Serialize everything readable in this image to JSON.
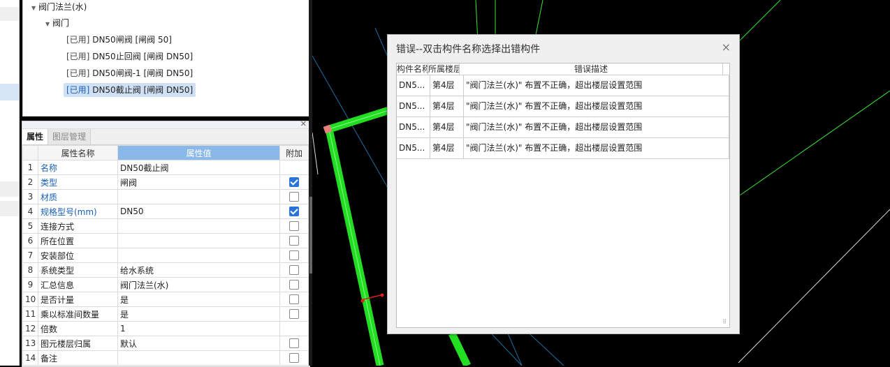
{
  "tree": {
    "group": "阀门法兰(水)",
    "subgroup": "阀门",
    "items": [
      {
        "tag": "[已用]",
        "label": "DN50闸阀 [闸阀 50]"
      },
      {
        "tag": "[已用]",
        "label": "DN50止回阀 [闸阀 DN50]"
      },
      {
        "tag": "[已用]",
        "label": "DN50闸阀-1 [闸阀 DN50]"
      },
      {
        "tag": "[已用]",
        "label": "DN50截止阀 [闸阀 DN50]"
      }
    ]
  },
  "props": {
    "tabs": [
      "属性",
      "图层管理"
    ],
    "headers": {
      "name": "属性名称",
      "value": "属性值",
      "extra": "附加"
    },
    "rows": [
      {
        "n": "1",
        "name": "名称",
        "value": "DN50截止阀",
        "blue": true,
        "cb": null
      },
      {
        "n": "2",
        "name": "类型",
        "value": "闸阀",
        "blue": true,
        "cb": true
      },
      {
        "n": "3",
        "name": "材质",
        "value": "",
        "blue": true,
        "cb": false
      },
      {
        "n": "4",
        "name": "规格型号(mm)",
        "value": "DN50",
        "blue": true,
        "cb": true
      },
      {
        "n": "5",
        "name": "连接方式",
        "value": "",
        "blue": false,
        "cb": false
      },
      {
        "n": "6",
        "name": "所在位置",
        "value": "",
        "blue": false,
        "cb": false
      },
      {
        "n": "7",
        "name": "安装部位",
        "value": "",
        "blue": false,
        "cb": false
      },
      {
        "n": "8",
        "name": "系统类型",
        "value": "给水系统",
        "blue": false,
        "cb": false
      },
      {
        "n": "9",
        "name": "汇总信息",
        "value": "阀门法兰(水)",
        "blue": false,
        "cb": false
      },
      {
        "n": "10",
        "name": "是否计量",
        "value": "是",
        "blue": false,
        "cb": false
      },
      {
        "n": "11",
        "name": "乘以标准间数量",
        "value": "是",
        "blue": false,
        "cb": false
      },
      {
        "n": "12",
        "name": "倍数",
        "value": "1",
        "blue": false,
        "cb": null
      },
      {
        "n": "13",
        "name": "图元楼层归属",
        "value": "默认",
        "blue": false,
        "cb": false
      },
      {
        "n": "14",
        "name": "备注",
        "value": "",
        "blue": false,
        "cb": false
      }
    ]
  },
  "dialog": {
    "title": "错误--双击构件名称选择出错构件",
    "close": "×",
    "headers": {
      "c1": "构件名称",
      "c2": "所属楼层",
      "c3": "错误描述"
    },
    "rows": [
      {
        "c1": "DN5...",
        "c2": "第4层",
        "c3": "\"阀门法兰(水)\" 布置不正确，超出楼层设置范围"
      },
      {
        "c1": "DN5...",
        "c2": "第4层",
        "c3": "\"阀门法兰(水)\" 布置不正确，超出楼层设置范围"
      },
      {
        "c1": "DN5...",
        "c2": "第4层",
        "c3": "\"阀门法兰(水)\" 布置不正确，超出楼层设置范围"
      },
      {
        "c1": "DN5...",
        "c2": "第4层",
        "c3": "\"阀门法兰(水)\" 布置不正确，超出楼层设置范围"
      }
    ]
  },
  "colors": {
    "pipe": "#22dd22",
    "line": "#39e639",
    "accent": "#8ab8e8"
  }
}
